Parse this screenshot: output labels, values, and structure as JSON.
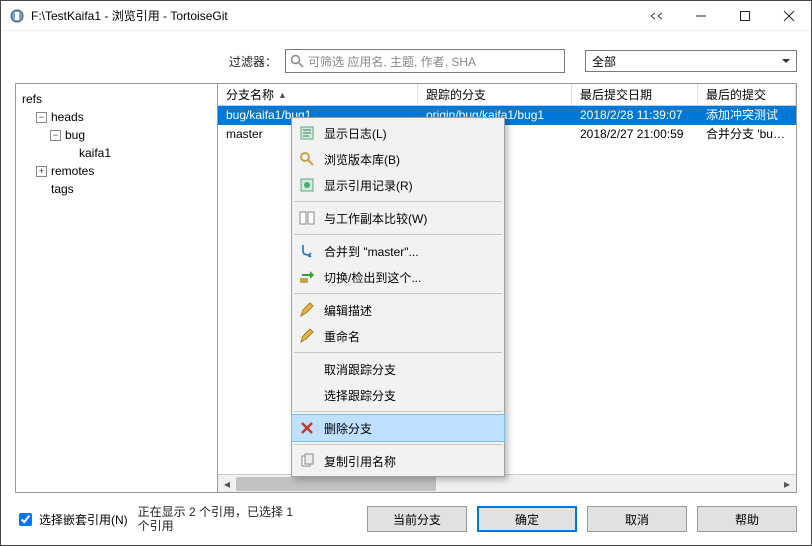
{
  "window": {
    "title": "F:\\TestKaifa1 - 浏览引用 - TortoiseGit"
  },
  "filter": {
    "label": "过滤器：",
    "placeholder": "可筛选 应用名, 主题, 作者, SHA",
    "scope_selected": "全部"
  },
  "tree": {
    "root": "refs",
    "nodes": [
      {
        "label": "heads",
        "depth": 1,
        "expander": "−"
      },
      {
        "label": "bug",
        "depth": 2,
        "expander": "−"
      },
      {
        "label": "kaifa1",
        "depth": 3,
        "expander": ""
      },
      {
        "label": "remotes",
        "depth": 1,
        "expander": "+"
      },
      {
        "label": "tags",
        "depth": 1,
        "expander": ""
      }
    ]
  },
  "columns": {
    "c0": "分支名称",
    "c1": "跟踪的分支",
    "c2": "最后提交日期",
    "c3": "最后的提交"
  },
  "rows": [
    {
      "branch": "bug/kaifa1/bug1",
      "tracked": "origin/bug/kaifa1/bug1",
      "date": "2018/2/28 11:39:07",
      "last": "添加冲突测试",
      "selected": true
    },
    {
      "branch": "master",
      "tracked": "",
      "date": "2018/2/27 21:00:59",
      "last": "合并分支 'bug/k",
      "selected": false
    }
  ],
  "context_menu": {
    "items": [
      {
        "label": "显示日志(L)",
        "icon": "log-icon"
      },
      {
        "label": "浏览版本库(B)",
        "icon": "browse-icon"
      },
      {
        "label": "显示引用记录(R)",
        "icon": "reflog-icon"
      },
      {
        "sep": true
      },
      {
        "label": "与工作副本比较(W)",
        "icon": "diff-icon"
      },
      {
        "sep": true
      },
      {
        "label": "合并到 \"master\"...",
        "icon": "merge-icon"
      },
      {
        "label": "切换/检出到这个...",
        "icon": "switch-icon"
      },
      {
        "sep": true
      },
      {
        "label": "编辑描述",
        "icon": "edit-icon"
      },
      {
        "label": "重命名",
        "icon": "rename-icon"
      },
      {
        "sep": true
      },
      {
        "label": "取消跟踪分支",
        "icon": ""
      },
      {
        "label": "选择跟踪分支",
        "icon": ""
      },
      {
        "sep": true
      },
      {
        "label": "删除分支",
        "icon": "delete-icon",
        "highlight": true
      },
      {
        "sep": true
      },
      {
        "label": "复制引用名称",
        "icon": "copy-icon"
      }
    ]
  },
  "footer": {
    "checkbox_label": "选择嵌套引用(N)",
    "status": "正在显示 2 个引用，已选择 1 个引用",
    "btn_current": "当前分支",
    "btn_ok": "确定",
    "btn_cancel": "取消",
    "btn_help": "帮助"
  }
}
